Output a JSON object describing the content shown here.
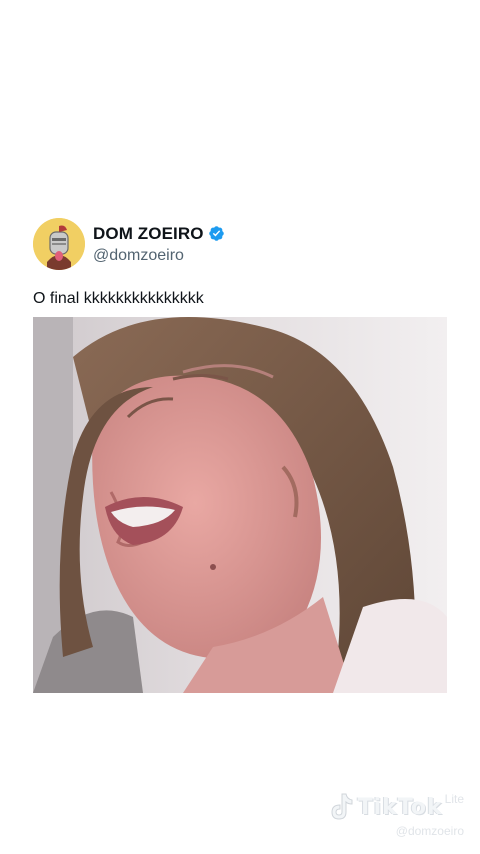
{
  "tweet": {
    "display_name": "DOM ZOEIRO",
    "handle": "@domzoeiro",
    "text": "O final kkkkkkkkkkkkkkk",
    "verified": true,
    "verified_color": "#1d9bf0"
  },
  "video": {
    "description_icon": "video-frame"
  },
  "watermark": {
    "brand": "TikTok",
    "suffix": "Lite",
    "username": "@domzoeiro"
  }
}
